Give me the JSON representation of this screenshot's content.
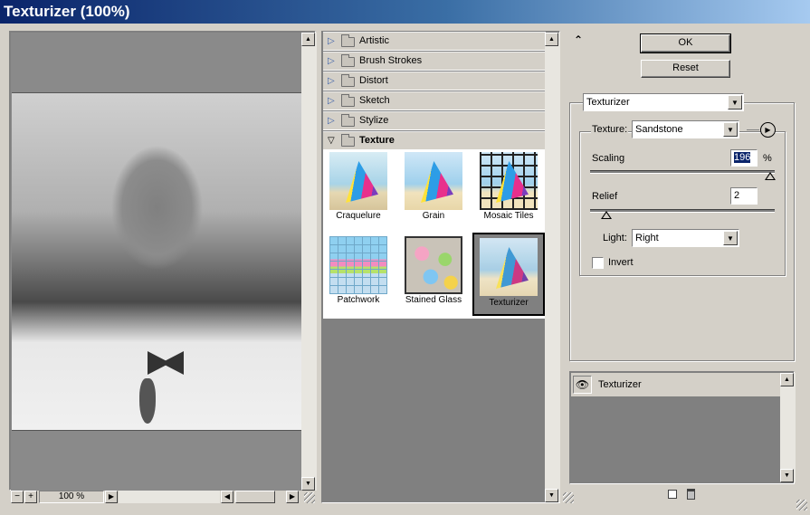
{
  "window": {
    "title": "Texturizer (100%)"
  },
  "preview": {
    "zoom_label": "100 %",
    "zoom_out": "−",
    "zoom_in": "+"
  },
  "filters": {
    "categories": [
      {
        "label": "Artistic",
        "expanded": false
      },
      {
        "label": "Brush Strokes",
        "expanded": false
      },
      {
        "label": "Distort",
        "expanded": false
      },
      {
        "label": "Sketch",
        "expanded": false
      },
      {
        "label": "Stylize",
        "expanded": false
      },
      {
        "label": "Texture",
        "expanded": true
      }
    ],
    "texture_filters": [
      {
        "label": "Craquelure",
        "icon": "craquelure-thumbnail"
      },
      {
        "label": "Grain",
        "icon": "grain-thumbnail"
      },
      {
        "label": "Mosaic Tiles",
        "icon": "mosaic-tiles-thumbnail"
      },
      {
        "label": "Patchwork",
        "icon": "patchwork-thumbnail"
      },
      {
        "label": "Stained Glass",
        "icon": "stained-glass-thumbnail"
      },
      {
        "label": "Texturizer",
        "icon": "texturizer-thumbnail",
        "selected": true
      }
    ]
  },
  "actions": {
    "ok": "OK",
    "reset": "Reset"
  },
  "settings": {
    "filter_select": "Texturizer",
    "texture_label": "Texture:",
    "texture_value": "Sandstone",
    "scaling_label": "Scaling",
    "scaling_value": "196",
    "scaling_unit": "%",
    "scaling_percent": 196,
    "relief_label": "Relief",
    "relief_value": "2",
    "relief_max": 50,
    "light_label": "Light:",
    "light_value": "Right",
    "invert_label": "Invert",
    "invert_checked": false
  },
  "layers": {
    "items": [
      {
        "label": "Texturizer",
        "visible": true
      }
    ]
  },
  "colors": {
    "title_start": "#0a246a",
    "title_end": "#a6caf0",
    "panel": "#d4d0c8",
    "dark": "#808080"
  }
}
